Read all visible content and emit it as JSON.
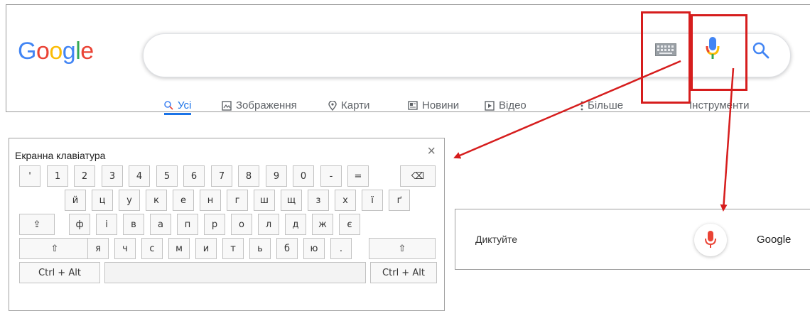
{
  "google": {
    "logo_letters": [
      {
        "ch": "G",
        "color": "#4285F4"
      },
      {
        "ch": "o",
        "color": "#EA4335"
      },
      {
        "ch": "o",
        "color": "#FBBC05"
      },
      {
        "ch": "g",
        "color": "#4285F4"
      },
      {
        "ch": "l",
        "color": "#34A853"
      },
      {
        "ch": "e",
        "color": "#EA4335"
      }
    ],
    "tabs": [
      {
        "label": "Усі",
        "icon": "search-icon",
        "active": true
      },
      {
        "label": "Зображення",
        "icon": "image-icon"
      },
      {
        "label": "Карти",
        "icon": "map-pin-icon"
      },
      {
        "label": "Новини",
        "icon": "news-icon"
      },
      {
        "label": "Відео",
        "icon": "video-icon"
      },
      {
        "label": "Більше",
        "icon": "more-vert-icon"
      },
      {
        "label": "Інструменти",
        "icon": ""
      }
    ],
    "highlight_color": "#d61d1d"
  },
  "keyboard": {
    "title": "Екранна клавіатура",
    "close": "×",
    "rows": [
      [
        "'",
        "1",
        "2",
        "3",
        "4",
        "5",
        "6",
        "7",
        "8",
        "9",
        "0",
        "-",
        "=",
        "⌫"
      ],
      [
        "й",
        "ц",
        "у",
        "к",
        "е",
        "н",
        "г",
        "ш",
        "щ",
        "з",
        "х",
        "ї",
        "ґ"
      ],
      [
        "⇪",
        "ф",
        "і",
        "в",
        "а",
        "п",
        "р",
        "о",
        "л",
        "д",
        "ж",
        "є"
      ],
      [
        "⇧",
        "я",
        "ч",
        "с",
        "м",
        "и",
        "т",
        "ь",
        "б",
        "ю",
        ".",
        "⇧"
      ],
      [
        "Ctrl + Alt",
        "",
        "Ctrl + Alt"
      ]
    ]
  },
  "dictation": {
    "prompt": "Диктуйте",
    "brand": "Google"
  }
}
